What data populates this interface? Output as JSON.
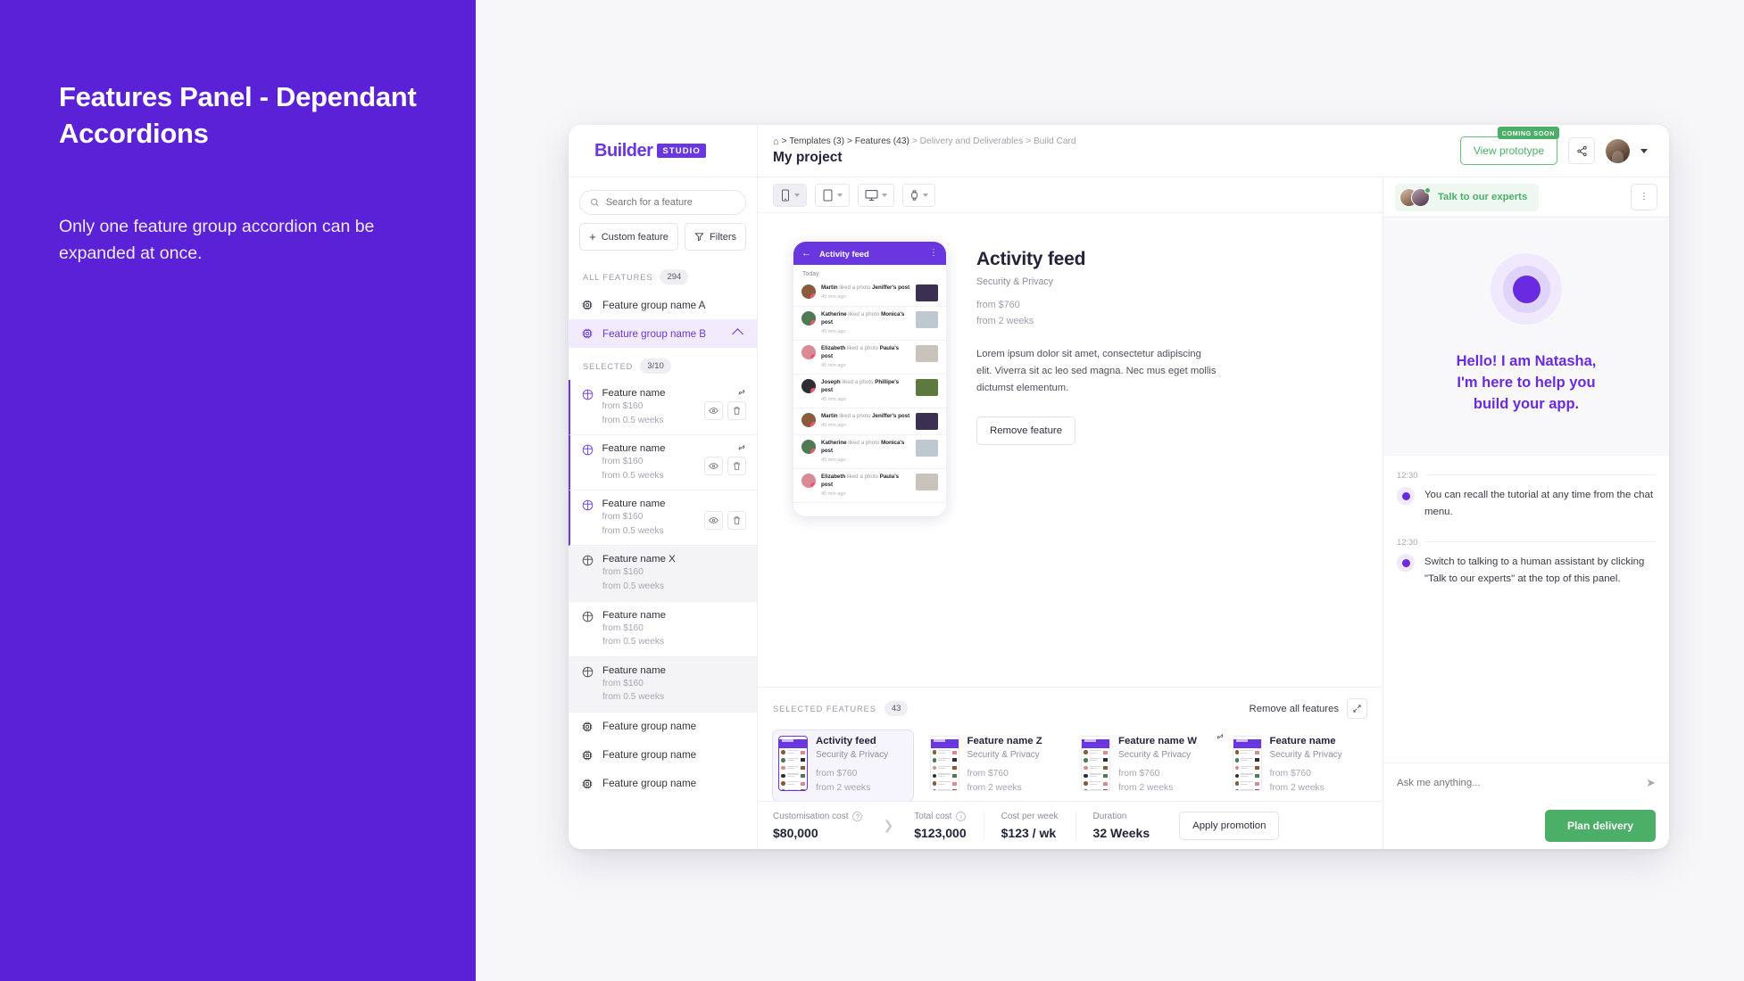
{
  "slide": {
    "title": "Features Panel - Dependant Accordions",
    "subtitle": "Only one feature group accordion can be expanded at once."
  },
  "topbar": {
    "logo_word": "Builder",
    "logo_chip": "STUDIO",
    "breadcrumb": "> Templates (3) > Features (43) > Delivery and Deliverables > Build Card",
    "crumb_home": "⌂",
    "crumb_templates": "> Templates (3)",
    "crumb_features": "> Features (43)",
    "crumb_delivery": "> Delivery and Deliverables",
    "crumb_build": "> Build Card",
    "project_title": "My project",
    "coming_soon": "COMING SOON",
    "view_prototype": "View prototype"
  },
  "sidebar": {
    "search_placeholder": "Search for a feature",
    "custom_feature": "Custom feature",
    "filters": "Filters",
    "all_features_label": "ALL FEATURES",
    "all_features_count": "294",
    "selected_label": "SELECTED",
    "selected_count": "3/10",
    "group_a": "Feature group name A",
    "group_b": "Feature group name B",
    "selected_features": [
      {
        "name": "Feature name",
        "price": "from $160",
        "time": "from 0.5 weeks"
      },
      {
        "name": "Feature name",
        "price": "from $160",
        "time": "from 0.5 weeks"
      },
      {
        "name": "Feature name",
        "price": "from $160",
        "time": "from 0.5 weeks"
      }
    ],
    "unselected_features": [
      {
        "name": "Feature name X",
        "price": "from $160",
        "time": "from 0.5 weeks"
      },
      {
        "name": "Feature name",
        "price": "from $160",
        "time": "from 0.5 weeks"
      },
      {
        "name": "Feature name",
        "price": "from $160",
        "time": "from 0.5 weeks"
      }
    ],
    "trailing_groups": [
      "Feature group name",
      "Feature group name",
      "Feature group name"
    ]
  },
  "devices": [
    {
      "name": "mobile-portrait",
      "active": true
    },
    {
      "name": "tablet",
      "active": false
    },
    {
      "name": "desktop",
      "active": false
    },
    {
      "name": "watch",
      "active": false
    }
  ],
  "phone_preview": {
    "title": "Activity feed",
    "today": "Today",
    "rows": [
      {
        "user": "Martin",
        "action": "liked a photo",
        "target": "Jeniffer's post",
        "time": "45 min ago",
        "ava": "#8a5a3c",
        "thumb": "#3b2f52"
      },
      {
        "user": "Katherine",
        "action": "liked a photo",
        "target": "Monica's post",
        "time": "45 min ago",
        "ava": "#4f7a52",
        "thumb": "#bfc7cf"
      },
      {
        "user": "Elizabeth",
        "action": "liked a photo",
        "target": "Paula's post",
        "time": "45 min ago",
        "ava": "#d98a94",
        "thumb": "#c9c3bb"
      },
      {
        "user": "Joseph",
        "action": "liked a photo",
        "target": "Phillipe's post",
        "time": "45 min ago",
        "ava": "#2e2e34",
        "thumb": "#5d7a3e"
      },
      {
        "user": "Martin",
        "action": "liked a photo",
        "target": "Jeniffer's post",
        "time": "45 min ago",
        "ava": "#8a5a3c",
        "thumb": "#3b2f52"
      },
      {
        "user": "Katherine",
        "action": "liked a photo",
        "target": "Monica's post",
        "time": "45 min ago",
        "ava": "#4f7a52",
        "thumb": "#bfc7cf"
      },
      {
        "user": "Elizabeth",
        "action": "liked a photo",
        "target": "Paula's post",
        "time": "45 min ago",
        "ava": "#d98a94",
        "thumb": "#c9c3bb"
      }
    ]
  },
  "detail": {
    "title": "Activity feed",
    "category": "Security & Privacy",
    "price": "from $760",
    "duration": "from 2 weeks",
    "description": "Lorem ipsum dolor sit amet, consectetur adipiscing elit. Viverra sit ac leo sed magna. Nec mus eget mollis dictumst elementum.",
    "remove_button": "Remove feature"
  },
  "selected_strip": {
    "label": "SELECTED FEATURES",
    "count": "43",
    "remove_all": "Remove all features",
    "cards": [
      {
        "name": "Activity feed",
        "category": "Security & Privacy",
        "price": "from $760",
        "duration": "from 2 weeks",
        "active": true,
        "pinned": false
      },
      {
        "name": "Feature name Z",
        "category": "Security & Privacy",
        "price": "from $760",
        "duration": "from 2 weeks",
        "active": false,
        "pinned": false
      },
      {
        "name": "Feature name W",
        "category": "Security & Privacy",
        "price": "from $760",
        "duration": "from 2 weeks",
        "active": false,
        "pinned": true
      },
      {
        "name": "Feature name",
        "category": "Security & Privacy",
        "price": "from $760",
        "duration": "from 2 weeks",
        "active": false,
        "pinned": false
      }
    ]
  },
  "cost_bar": {
    "customisation_label": "Customisation cost",
    "customisation_value": "$80,000",
    "total_label": "Total cost",
    "total_value": "$123,000",
    "per_week_label": "Cost per week",
    "per_week_value": "$123 / wk",
    "duration_label": "Duration",
    "duration_value": "32 Weeks",
    "apply_promotion": "Apply promotion"
  },
  "chat": {
    "experts_label": "Talk to our experts",
    "hero_line1": "Hello! I am Natasha,",
    "hero_line2": "I'm here to help you",
    "hero_line3": "build your app.",
    "messages": [
      {
        "time": "12:30",
        "text": "You can recall the tutorial at any time from the chat menu."
      },
      {
        "time": "12:30",
        "text": "Switch to talking to a human assistant by clicking \"Talk to our experts\" at the top of this panel."
      }
    ],
    "ask_placeholder": "Ask me anything...",
    "plan_delivery": "Plan delivery"
  },
  "colors": {
    "brand_purple": "#6a36e0",
    "slide_purple": "#5b21d6",
    "green": "#4caf68",
    "hero_purple": "#6a2ae0"
  }
}
